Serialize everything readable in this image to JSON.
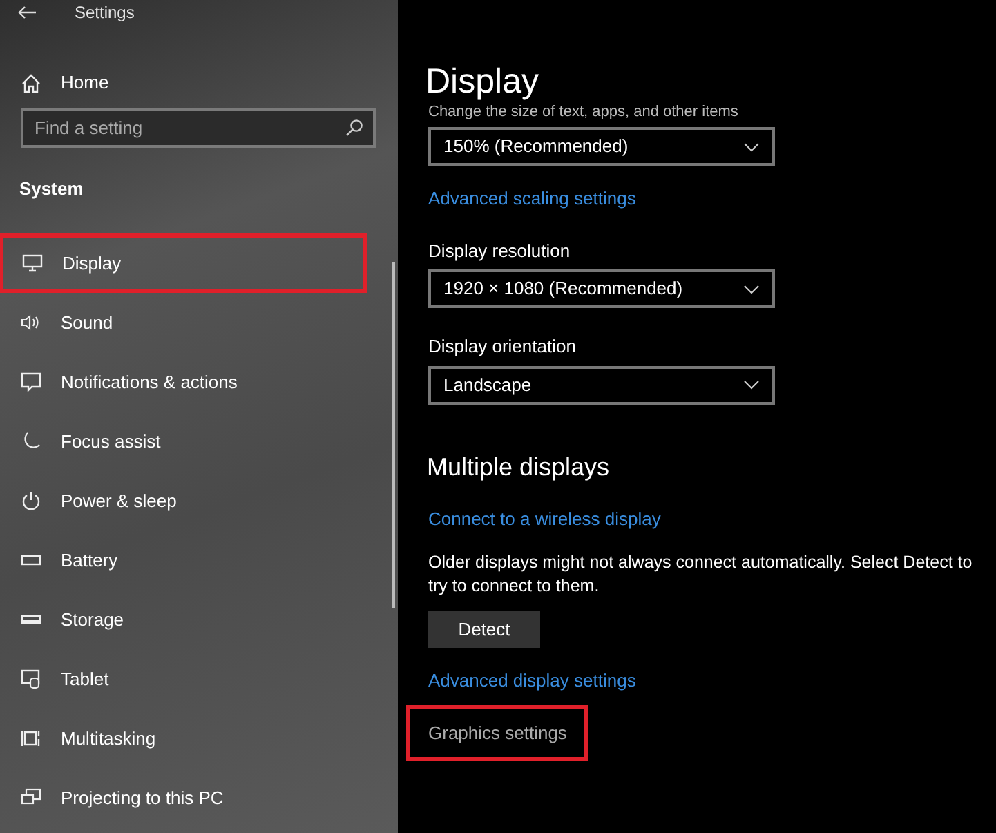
{
  "window": {
    "title": "Settings"
  },
  "sidebar": {
    "home": "Home",
    "search": {
      "placeholder": "Find a setting"
    },
    "section": "System",
    "items": [
      {
        "label": "Display",
        "highlighted": true
      },
      {
        "label": "Sound",
        "highlighted": false
      },
      {
        "label": "Notifications & actions",
        "highlighted": false
      },
      {
        "label": "Focus assist",
        "highlighted": false
      },
      {
        "label": "Power & sleep",
        "highlighted": false
      },
      {
        "label": "Battery",
        "highlighted": false
      },
      {
        "label": "Storage",
        "highlighted": false
      },
      {
        "label": "Tablet",
        "highlighted": false
      },
      {
        "label": "Multitasking",
        "highlighted": false
      },
      {
        "label": "Projecting to this PC",
        "highlighted": false
      }
    ]
  },
  "content": {
    "title": "Display",
    "items": [
      {
        "kind": "caption",
        "text": "Change the size of text, apps, and other items"
      },
      {
        "kind": "dropdown",
        "value": "150% (Recommended)"
      },
      {
        "kind": "link",
        "text": "Advanced scaling settings",
        "highlighted": false
      },
      {
        "kind": "label",
        "text": "Display resolution"
      },
      {
        "kind": "dropdown",
        "value": "1920 × 1080 (Recommended)"
      },
      {
        "kind": "label",
        "text": "Display orientation"
      },
      {
        "kind": "dropdown",
        "value": "Landscape"
      },
      {
        "kind": "heading",
        "text": "Multiple displays"
      },
      {
        "kind": "link",
        "text": "Connect to a wireless display",
        "highlighted": false
      },
      {
        "kind": "paragraph",
        "text": "Older displays might not always connect automatically. Select Detect to try to connect to them."
      },
      {
        "kind": "button",
        "text": "Detect"
      },
      {
        "kind": "link",
        "text": "Advanced display settings",
        "highlighted": false
      },
      {
        "kind": "graylink",
        "text": "Graphics settings",
        "highlighted": true
      }
    ]
  }
}
